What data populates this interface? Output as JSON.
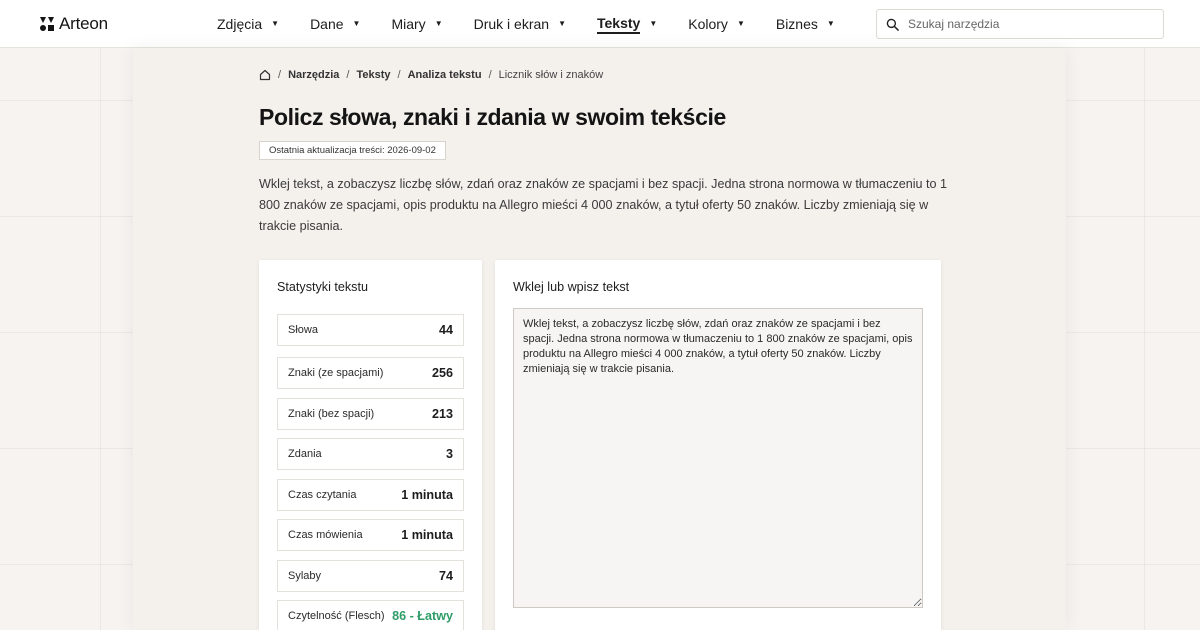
{
  "brand": {
    "name": "Arteon"
  },
  "nav": {
    "items": [
      {
        "label": "Zdjęcia",
        "active": false
      },
      {
        "label": "Dane",
        "active": false
      },
      {
        "label": "Miary",
        "active": false
      },
      {
        "label": "Druk i ekran",
        "active": false
      },
      {
        "label": "Teksty",
        "active": true
      },
      {
        "label": "Kolory",
        "active": false
      },
      {
        "label": "Biznes",
        "active": false
      }
    ]
  },
  "search": {
    "placeholder": "Szukaj narzędzia",
    "icon": "search-icon"
  },
  "breadcrumb": {
    "home_icon": "home-icon",
    "items": [
      "Narzędzia",
      "Teksty",
      "Analiza tekstu"
    ],
    "current": "Licznik słów i znaków"
  },
  "page": {
    "title": "Policz słowa, znaki i zdania w swoim tekście",
    "updated": "Ostatnia aktualizacja treści: 2026-09-02",
    "intro": "Wklej tekst, a zobaczysz liczbę słów, zdań oraz znaków ze spacjami i bez spacji. Jedna strona normowa w tłumaczeniu to 1 800 znaków ze spacjami, opis produktu na Allegro mieści 4 000 znaków, a tytuł oferty 50 znaków. Liczby zmieniają się w trakcie pisania."
  },
  "stats": {
    "title": "Statystyki tekstu",
    "rows": [
      {
        "label": "Słowa",
        "value": "44"
      },
      {
        "label": "Znaki (ze spacjami)",
        "value": "256"
      },
      {
        "label": "Znaki (bez spacji)",
        "value": "213"
      },
      {
        "label": "Zdania",
        "value": "3"
      },
      {
        "label": "Czas czytania",
        "value": "1 minuta"
      },
      {
        "label": "Czas mówienia",
        "value": "1 minuta"
      },
      {
        "label": "Sylaby",
        "value": "74"
      },
      {
        "label": "Czytelność (Flesch)",
        "value": "86 - Łatwy",
        "color": "#2e9c67"
      }
    ]
  },
  "editor": {
    "title": "Wklej lub wpisz tekst",
    "value": "Wklej tekst, a zobaczysz liczbę słów, zdań oraz znaków ze spacjami i bez spacji. Jedna strona normowa w tłumaczeniu to 1 800 znaków ze spacjami, opis produktu na Allegro mieści 4 000 znaków, a tytuł oferty 50 znaków. Liczby zmieniają się w trakcie pisania."
  },
  "colors": {
    "accent_green": "#2e9c67",
    "page_background": "#f6f3f0",
    "panel_background": "#f4f1ed",
    "text": "#1d1d1f"
  }
}
